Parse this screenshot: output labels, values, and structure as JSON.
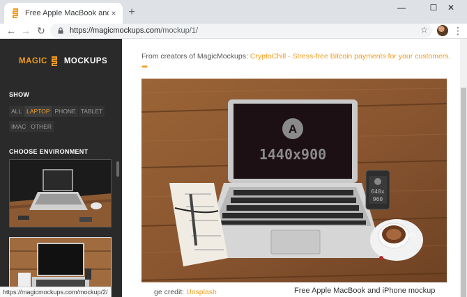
{
  "tab": {
    "title": "Free Apple MacBook and iPhone",
    "close": "×"
  },
  "newtab": "+",
  "window_controls": {
    "minimize": "—",
    "maximize": "☐",
    "close": "✕"
  },
  "nav": {
    "back": "←",
    "forward": "→",
    "reload": "↻"
  },
  "omnibox": {
    "url_main": "https://magicmockups.com",
    "url_path": "/mockup/1/",
    "star": "☆"
  },
  "menu_dots": "⋮",
  "sidebar": {
    "logo_left": "MAGIC",
    "logo_right": "MOCKUPS",
    "show_title": "SHOW",
    "filters": [
      {
        "label": "ALL",
        "active": false
      },
      {
        "label": "LAPTOP",
        "active": true
      },
      {
        "label": "PHONE",
        "active": false
      },
      {
        "label": "TABLET",
        "active": false
      },
      {
        "label": "IMAC",
        "active": false
      },
      {
        "label": "OTHER",
        "active": false
      }
    ],
    "env_title": "CHOOSE ENVIRONMENT"
  },
  "main": {
    "promo_prefix": "From creators of MagicMockups:",
    "promo_link": "CryptoChill - Stress-free Bitcoin payments for your customers.",
    "arrow": "➦",
    "screen_letter": "A",
    "screen_size": "1440x900",
    "phone_text_1": "640x",
    "phone_text_2": "960",
    "credit_prefix": "ge credit:",
    "credit_link": "Unsplash"
  },
  "status_url": "https://magicmockups.com/mockup/2/",
  "caption": "Free Apple MacBook and iPhone mockup",
  "colors": {
    "accent": "#f29b1e",
    "sidebar_bg": "#2a2a2a",
    "wood": "#8a5a34"
  }
}
